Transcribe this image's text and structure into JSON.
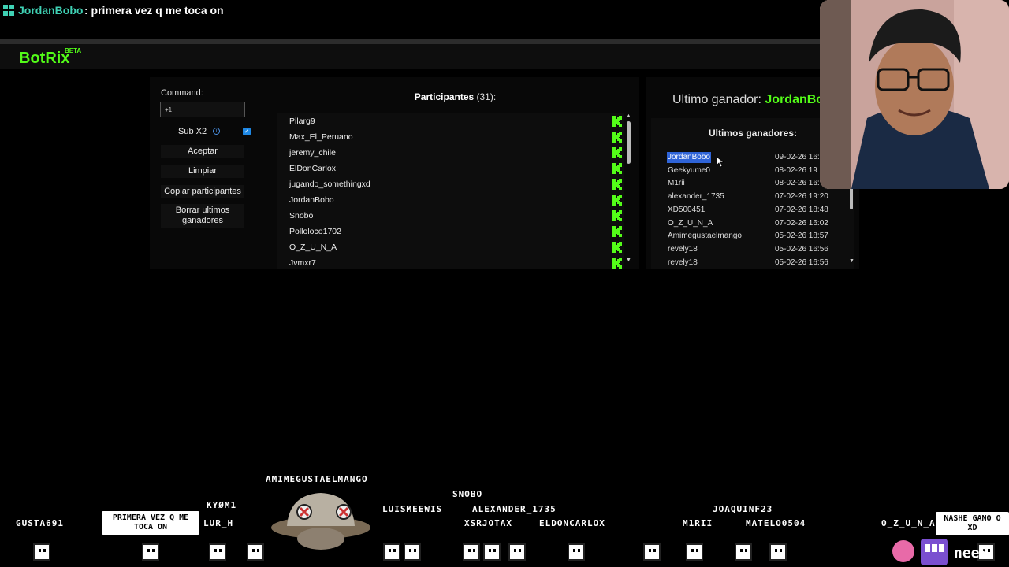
{
  "chat": {
    "user": "JordanBobo",
    "message": ": primera vez q me toca on"
  },
  "brand": {
    "logo": "BotRix",
    "badge": "BETA"
  },
  "controls": {
    "command_label": "Command:",
    "command_value": "+1",
    "sub_label": "Sub X2",
    "sub_checked": true,
    "accept": "Aceptar",
    "clear": "Limpiar",
    "copy": "Copiar participantes",
    "delete_line1": "Borrar ultimos",
    "delete_line2": "ganadores"
  },
  "participants": {
    "title": "Participantes",
    "count": "(31):",
    "items": [
      "Pilarg9",
      "Max_El_Peruano",
      "jeremy_chile",
      "ElDonCarlox",
      "jugando_somethingxd",
      "JordanBobo",
      "Snobo",
      "Polloloco1702",
      "O_Z_U_N_A",
      "Jvmxr7"
    ]
  },
  "winner": {
    "label": "Ultimo ganador:",
    "name": "JordanBobo"
  },
  "winners": {
    "title": "Ultimos ganadores:",
    "rows": [
      {
        "name": "JordanBobo",
        "date": "09-02-26 16:"
      },
      {
        "name": "Geekyume0",
        "date": "08-02-26 19"
      },
      {
        "name": "M1rii",
        "date": "08-02-26 16:"
      },
      {
        "name": "alexander_1735",
        "date": "07-02-26 19:20"
      },
      {
        "name": "XD500451",
        "date": "07-02-26 18:48"
      },
      {
        "name": "O_Z_U_N_A",
        "date": "07-02-26 16:02"
      },
      {
        "name": "Amimegustaelmango",
        "date": "05-02-26 18:57"
      },
      {
        "name": "revely18",
        "date": "05-02-26 16:56"
      },
      {
        "name": "revely18",
        "date": "05-02-26 16:56"
      }
    ]
  },
  "stream_overlay": {
    "names": {
      "gusta": "GUSTA691",
      "kyom": "KYØM1",
      "lur": "LUR_H",
      "mango": "AMIMEGUSTAELMANGO",
      "snobo": "SNOBO",
      "luis": "LUISMEEWIS",
      "alex": "ALEXANDER_1735",
      "xsr": "XSRJOTAX",
      "eldon": "ELDONCARLOX",
      "joaquin": "JOAQUINF23",
      "mirii": "M1RII",
      "matelo": "MATELO0504",
      "ozuna": "O_Z_U_N_A",
      "nee": "nee",
      "nee_s": "S"
    },
    "bubble1_line1": "PRIMERA VEZ Q ME",
    "bubble1_line2": "TOCA ON",
    "bubble2_line1": "NASHE GANO O",
    "bubble2_line2": "XD"
  },
  "colors": {
    "kick_green": "#53fc18",
    "chat_user": "#3fd1b4",
    "selection": "#2f64d8"
  }
}
